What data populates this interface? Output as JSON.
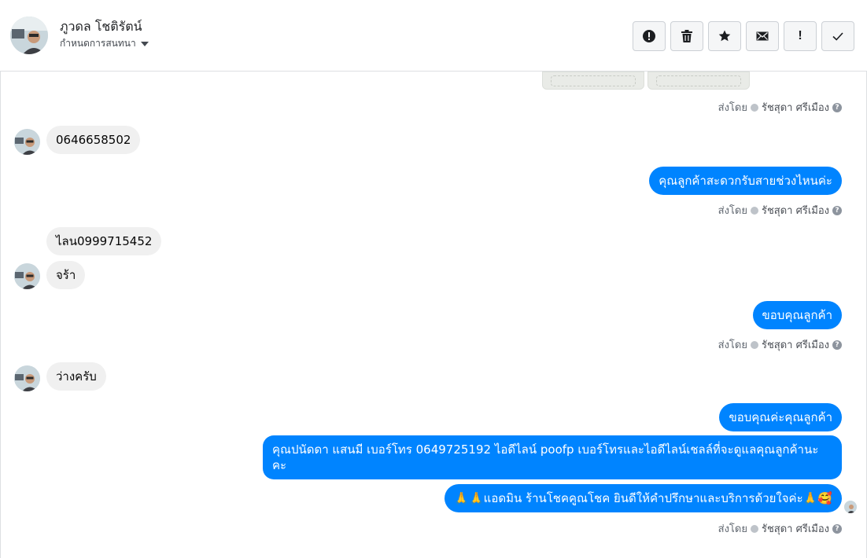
{
  "contact": {
    "name": "ภูวดล โชติรัตน์",
    "assign_label": "กำหนดการสนทนา"
  },
  "toolbar": {
    "spam_icon": "alert-circle-icon",
    "delete_icon": "trash-icon",
    "star_icon": "star-icon",
    "unread_icon": "envelope-icon",
    "follow_up_label": "!",
    "done_icon": "checkmark-icon"
  },
  "sent_by": {
    "prefix": "ส่งโดย",
    "agent": "รัชสุดา ศรีเมือง",
    "help": "?"
  },
  "messages": [
    {
      "dir": "in",
      "text": "0646658502"
    },
    {
      "dir": "out",
      "text": "คุณลูกค้าสะดวกรับสายช่วงไหนค่ะ"
    },
    {
      "dir": "in",
      "text": "ไลน0999715452"
    },
    {
      "dir": "in",
      "text": "จร้า"
    },
    {
      "dir": "out",
      "text": "ขอบคุณลูกค้า"
    },
    {
      "dir": "in",
      "text": "ว่างครับ"
    },
    {
      "dir": "out",
      "text": "ขอบคุณค่ะคุณลูกค้า"
    },
    {
      "dir": "out",
      "text": "คุณปนัดดา แสนมี   เบอร์โทร 0649725192  ไอดีไลน์ poofp   เบอร์โทรและไอดีไลน์เชลล์ที่จะดูแลคุณลูกค้านะคะ"
    },
    {
      "dir": "out",
      "text": "🙏🙏แอดมิน ร้านโชคคูณโชค ยินดีให้คำปรึกษาและบริการด้วยใจค่ะ🙏🥰"
    }
  ],
  "colors": {
    "outgoing_bubble": "#0084ff",
    "incoming_bubble": "#f0f0f0",
    "border": "#dddfe2"
  }
}
